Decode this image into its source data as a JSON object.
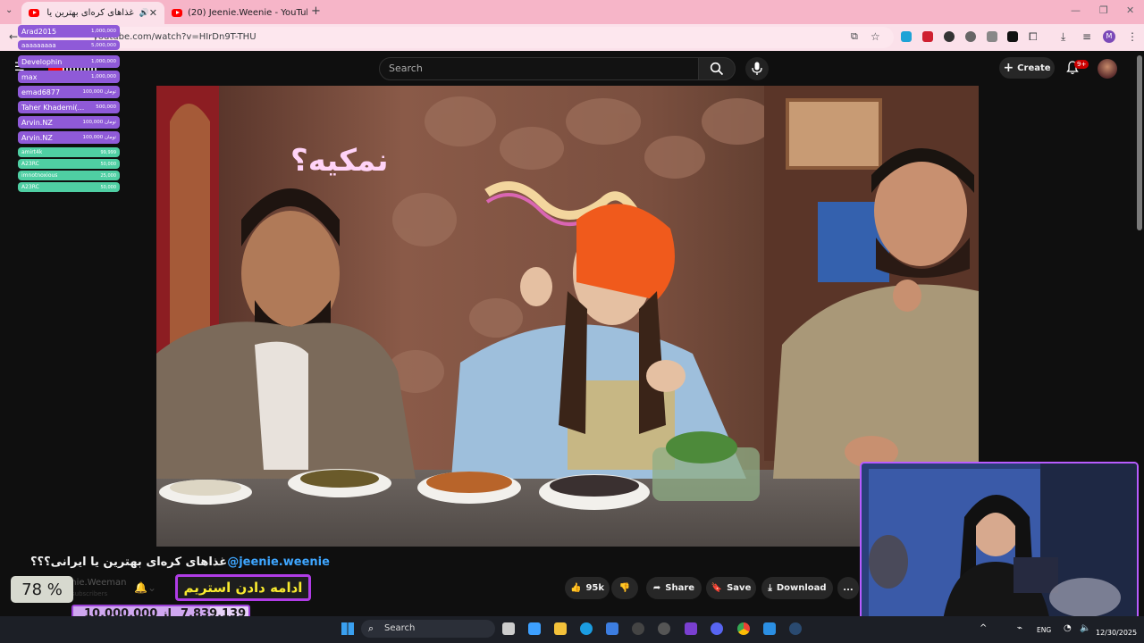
{
  "browser": {
    "tabs": [
      {
        "title": "غذاهای کره‌ای بهترین یا ا",
        "has_audio": true,
        "active": true
      },
      {
        "title": "(20) Jeenie.Weenie - YouTube",
        "has_audio": false,
        "active": false
      }
    ],
    "new_tab_label": "+",
    "url": "youtube.com/watch?v=HIrDn9T-THU",
    "profile_initial": "M"
  },
  "youtube": {
    "search_placeholder": "Search",
    "create_label": "Create",
    "notification_badge": "9+"
  },
  "donations": {
    "top": [
      {
        "name": "Arad2015",
        "amount": "1,000,000"
      },
      {
        "name": "aaaaaaaaa",
        "amount": "5,000,000"
      },
      {
        "name": "Develophin",
        "amount": "1,000,000"
      },
      {
        "name": "max",
        "amount": "1,000,000"
      },
      {
        "name": "emad6877",
        "amount": "تومان 100,000"
      },
      {
        "name": "Taher Khademi(...",
        "amount": "500,000"
      },
      {
        "name": "Arvin.NZ",
        "amount": "تومان 100,000"
      },
      {
        "name": "Arvin.NZ",
        "amount": "تومان 100,000"
      }
    ],
    "recent": [
      {
        "name": "amirt4k",
        "amount": "99,999"
      },
      {
        "name": "A23RC",
        "amount": "50,000"
      },
      {
        "name": "imnotnoxious",
        "amount": "25,000"
      },
      {
        "name": "A23RC",
        "amount": "50,000"
      }
    ]
  },
  "video": {
    "neon_sign_1": "نمکیه؟",
    "title_handle": "@jeenie.weenie",
    "title_text": "غذاهای کره‌ای بهترین یا ایرانی؟؟؟",
    "channel_name": "Jeenie.Weeman",
    "subscribers": "subscribers",
    "likes": "95k",
    "share_label": "Share",
    "save_label": "Save",
    "download_label": "Download",
    "more_label": "..."
  },
  "stream_overlay": {
    "progress_percent": "78 %",
    "continue_stream_label": "ادامه دادن استریم",
    "goal_current": "7,839,139",
    "goal_separator": "از",
    "goal_target": "10,000,000"
  },
  "taskbar": {
    "search_label": "Search",
    "language": "ENG",
    "date": "12/30/2025"
  }
}
